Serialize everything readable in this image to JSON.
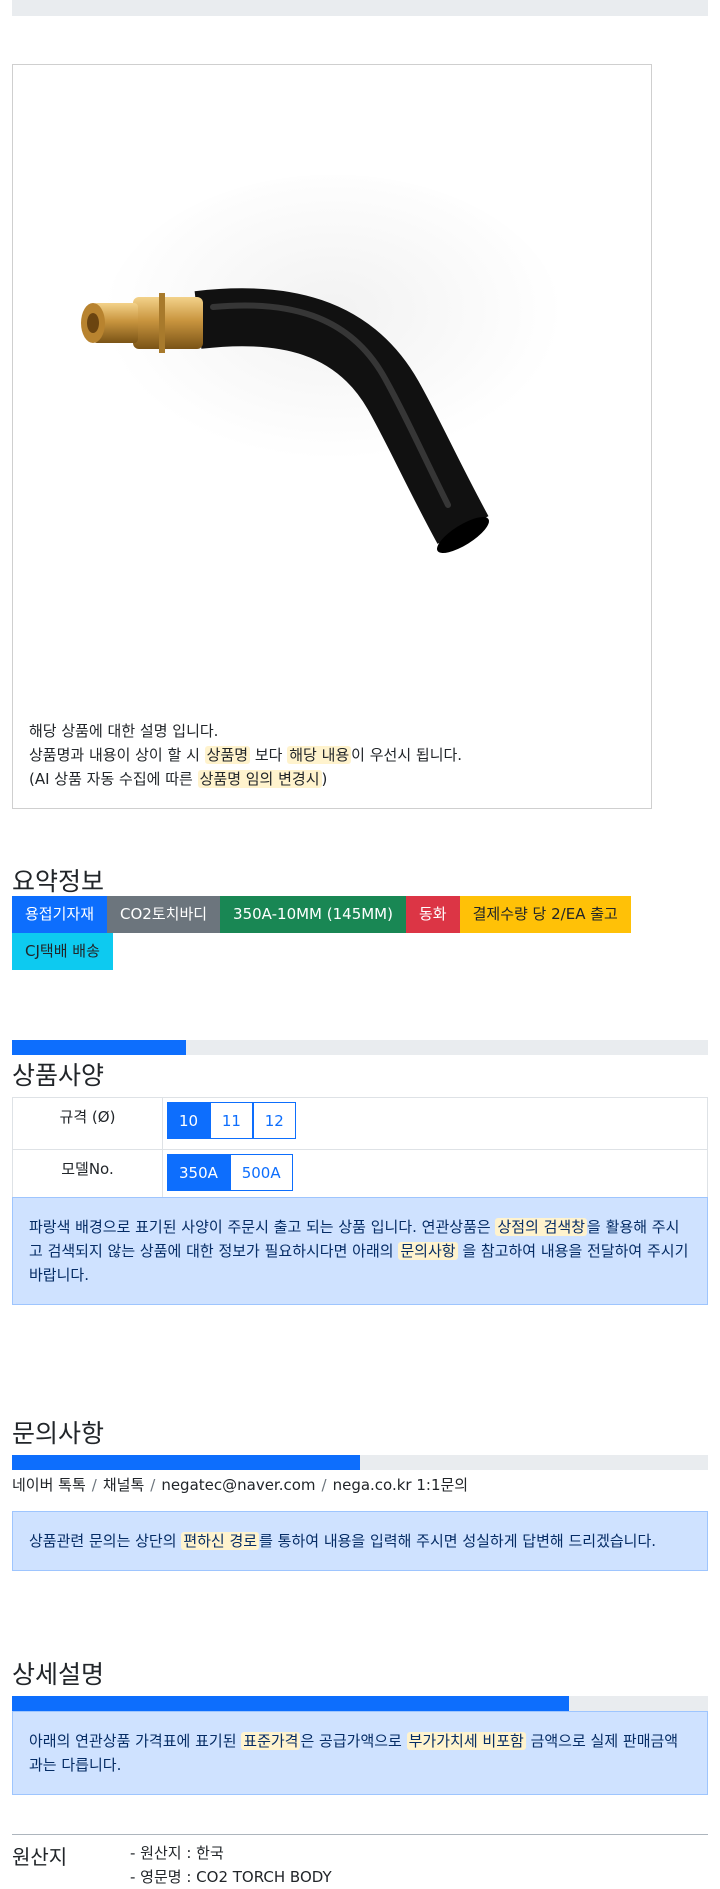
{
  "product": {
    "desc_line1": "해당 상품에 대한 설명 입니다.",
    "desc_line2_a": "상품명과 내용이 상이 할 시 ",
    "desc_line2_hl1": "상품명",
    "desc_line2_b": " 보다 ",
    "desc_line2_hl2": "해당 내용",
    "desc_line2_c": "이 우선시 됩니다.",
    "desc_line3_a": "(AI 상품 자동 수집에 따른 ",
    "desc_line3_hl": "상품명 임의 변경시",
    "desc_line3_b": ")"
  },
  "summary": {
    "title": "요약정보",
    "badges": [
      "용접기자재",
      "CO2토치바디",
      "350A-10MM (145MM)",
      "동화",
      "결제수량 당 2/EA 출고",
      "CJ택배 배송"
    ]
  },
  "spec": {
    "title": "상품사양",
    "progress_fraction": 0.25,
    "rows": [
      {
        "label": "규격 (Ø)",
        "options": [
          "10",
          "11",
          "12"
        ],
        "selected": "10"
      },
      {
        "label": "모델No.",
        "options": [
          "350A",
          "500A"
        ],
        "selected": "350A"
      }
    ],
    "notice": {
      "a": "파랑색 배경으로 표기된 사양이 주문시 출고 되는 상품 입니다. 연관상품은 ",
      "hl1": "상점의 검색창",
      "b": "을 활용해 주시고 검색되지 않는 상품에 대한 정보가 필요하시다면 아래의 ",
      "hl2": "문의사항",
      "c": " 을 참고하여 내용을 전달하여 주시기 바랍니다."
    }
  },
  "inquiry": {
    "title": "문의사항",
    "progress_fraction": 0.5,
    "channels": [
      "네이버 톡톡",
      "채널톡",
      "negatec@naver.com",
      "nega.co.kr 1:1문의"
    ],
    "notice": {
      "a": "상품관련 문의는 상단의 ",
      "hl": "편하신 경로",
      "b": "를 통하여 내용을 입력해 주시면 성실하게 답변해 드리겠습니다."
    }
  },
  "detail": {
    "title": "상세설명",
    "progress_fraction": 0.8,
    "notice": {
      "a": "아래의 연관상품 가격표에 표기된 ",
      "hl1": "표준가격",
      "b": "은 공급가액으로 ",
      "hl2": "부가가치세 비포함",
      "c": " 금액으로 실제 판매금액과는 다릅니다."
    }
  },
  "origin": {
    "label": "원산지",
    "line1": "- 원산지 : 한국",
    "line2": "- 영문명 : CO2 TORCH BODY"
  },
  "colors": {
    "primary": "#0d6efd",
    "alert_bg": "#cfe2ff",
    "highlight": "#fff3cd"
  }
}
